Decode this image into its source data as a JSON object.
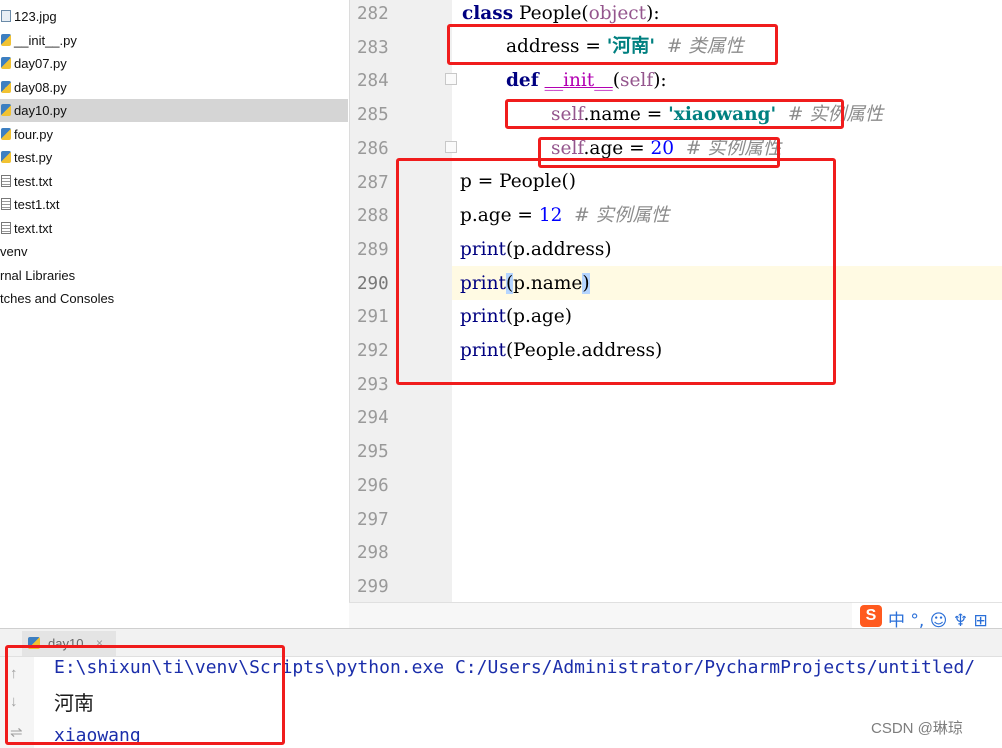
{
  "project_tree": {
    "items": [
      {
        "label": "123.jpg",
        "icon": "image-file-icon"
      },
      {
        "label": "__init__.py",
        "icon": "python-file-icon"
      },
      {
        "label": "day07.py",
        "icon": "python-file-icon"
      },
      {
        "label": "day08.py",
        "icon": "python-file-icon"
      },
      {
        "label": "day10.py",
        "icon": "python-file-icon"
      },
      {
        "label": "four.py",
        "icon": "python-file-icon"
      },
      {
        "label": "test.py",
        "icon": "python-file-icon"
      },
      {
        "label": "test.txt",
        "icon": "text-file-icon"
      },
      {
        "label": "test1.txt",
        "icon": "text-file-icon"
      },
      {
        "label": "text.txt",
        "icon": "text-file-icon"
      },
      {
        "label": "venv"
      },
      {
        "label": "rnal Libraries"
      },
      {
        "label": "tches and Consoles"
      }
    ],
    "selected": "day10.py"
  },
  "editor": {
    "line_numbers": [
      "282",
      "283",
      "284",
      "285",
      "286",
      "287",
      "288",
      "289",
      "290",
      "291",
      "292",
      "293",
      "294",
      "295",
      "296",
      "297",
      "298",
      "299"
    ],
    "current_line": "290",
    "code": {
      "l282": {
        "kw": "class",
        "rest": " People(",
        "obj": "object",
        "end": "):"
      },
      "l283": {
        "name": "address",
        "eq": " = ",
        "str": "'河南'",
        "cm": "  # 类属性"
      },
      "l284": {
        "kw": "def",
        "sp": " ",
        "dunder": "__init__",
        "open": "(",
        "self": "self",
        "close": "):"
      },
      "l285": {
        "self": "self",
        "attr": ".name = ",
        "str": "'xiaowang'",
        "cm": "  # 实例属性"
      },
      "l286": {
        "self": "self",
        "attr": ".age = ",
        "num": "20",
        "cm": "  # 实例属性"
      },
      "l287": {
        "text": "p = People()"
      },
      "l288": {
        "a": "p.age = ",
        "num": "12",
        "cm": "  # 实例属性"
      },
      "l289": {
        "fn": "print",
        "args": "(p.address)"
      },
      "l290": {
        "fn": "print",
        "open": "(",
        "mid": "p.name",
        "close": ")"
      },
      "l291": {
        "fn": "print",
        "args": "(p.age)"
      },
      "l292": {
        "fn": "print",
        "args": "(People.address)"
      }
    }
  },
  "ime_bar": {
    "logo": "S",
    "text": "中 °, ☺ ♆ ⊞",
    "color": "#ff5a1f"
  },
  "run_panel": {
    "tab_label": "day10",
    "tab_close": "×",
    "output": [
      "E:\\shixun\\ti\\venv\\Scripts\\python.exe C:/Users/Administrator/PycharmProjects/untitled/",
      "河南",
      "xiaowang"
    ],
    "controls": {
      "up": "↑",
      "down": "↓",
      "wrap": "⇌"
    }
  },
  "watermark": "CSDN @琳琼",
  "colors": {
    "highlight_box": "#f01c1c",
    "current_line": "#fffae3",
    "selection": "#d5d5d5"
  }
}
